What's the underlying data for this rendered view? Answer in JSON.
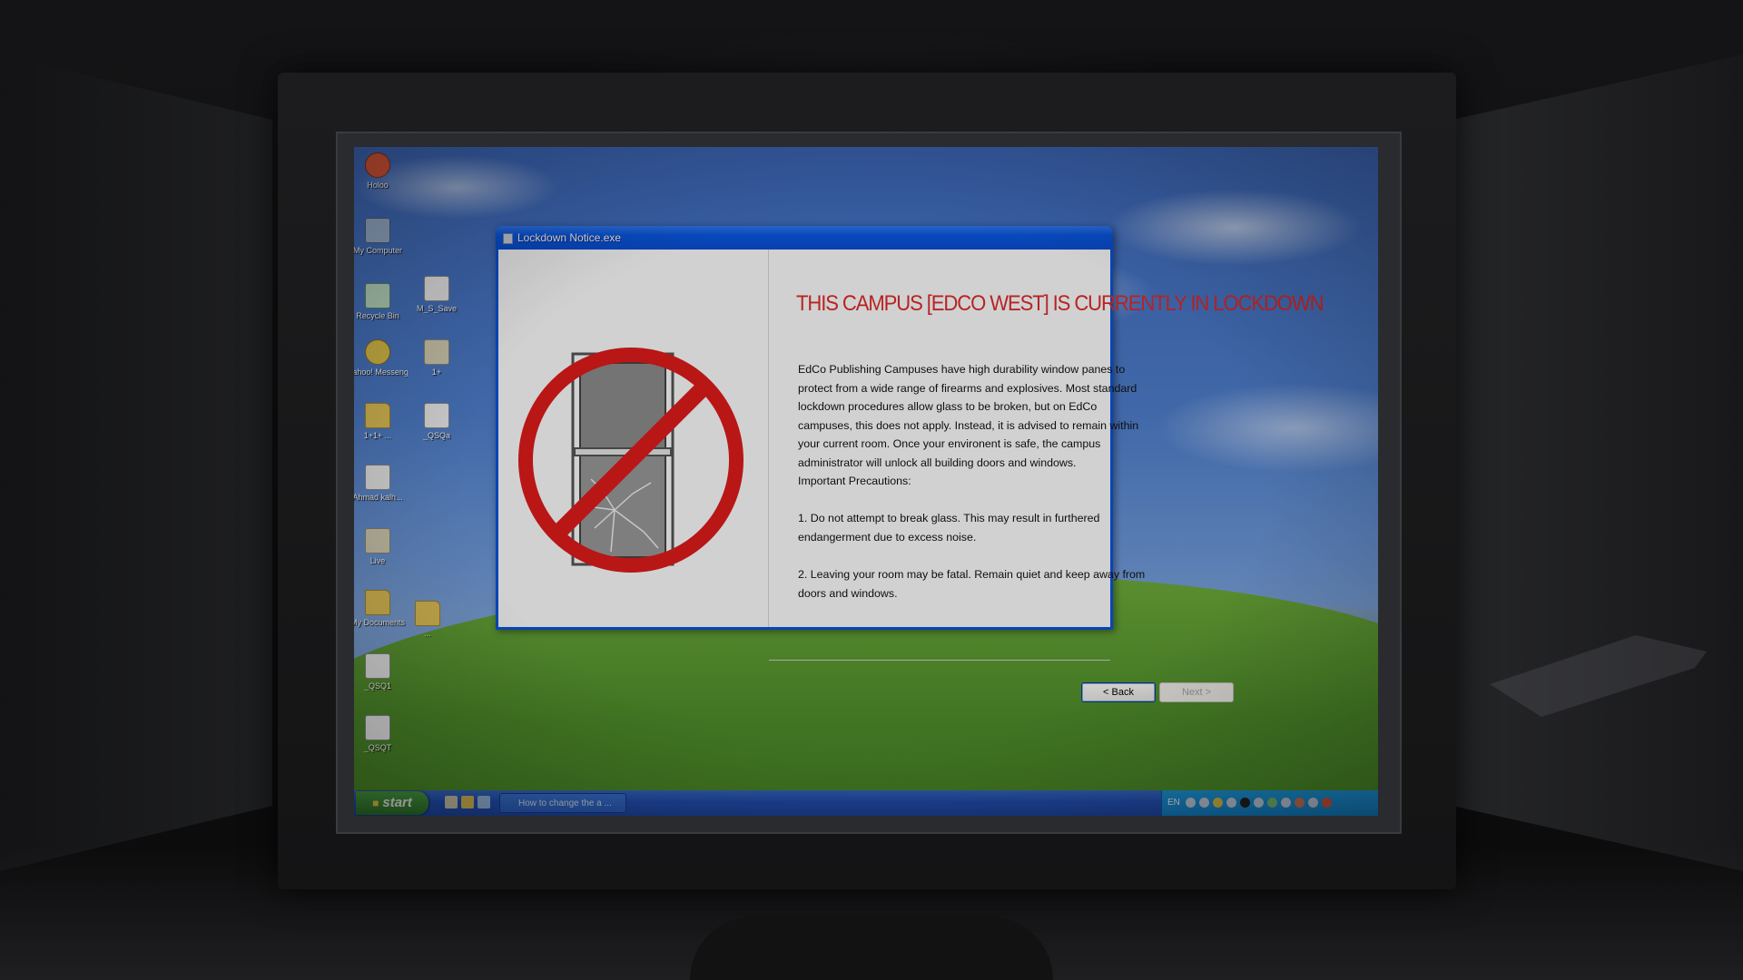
{
  "dialog": {
    "title": "Lockdown Notice.exe",
    "headline": "THIS CAMPUS [EDCO WEST] IS CURRENTLY IN LOCKDOWN",
    "paragraph1": "EdCo Publishing Campuses have high durability window panes to protect from a wide range of firearms and explosives. Most standard lockdown procedures allow glass to be broken, but on EdCo campuses, this does not apply. Instead, it is advised to remain within your current room. Once your environent is safe, the campus administrator will unlock all building doors and windows.",
    "precautions_heading": "Important Precautions:",
    "precaution1": "1. Do not attempt to break glass. This may result in furthered endangerment due to excess noise.",
    "precaution2": "2. Leaving your room may be fatal. Remain quiet and keep away from doors and windows.",
    "back_label": "< Back",
    "next_label": "Next >",
    "headline_color": "#e02b2b",
    "sign_icon": "no-window-breaking-icon"
  },
  "desktop": {
    "icons": [
      {
        "label": "Holoo",
        "icon": "holoo-icon"
      },
      {
        "label": "My Computer",
        "icon": "my-computer-icon"
      },
      {
        "label": "Recycle Bin",
        "icon": "recycle-bin-icon"
      },
      {
        "label": "M_S_Save",
        "icon": "file-icon"
      },
      {
        "label": "Yahoo! Messenger",
        "icon": "yahoo-messenger-icon"
      },
      {
        "label": "1+",
        "icon": "shortcut-icon"
      },
      {
        "label": "1+1+ ...",
        "icon": "folder-icon"
      },
      {
        "label": "_QSQa",
        "icon": "file-icon"
      },
      {
        "label": "Ahmad kalh...",
        "icon": "document-icon"
      },
      {
        "label": "Live",
        "icon": "live-icon"
      },
      {
        "label": "My Documents",
        "icon": "my-documents-icon"
      },
      {
        "label": "...",
        "icon": "folder-icon"
      },
      {
        "label": "_QSQ1",
        "icon": "file-icon"
      },
      {
        "label": "_QSQT",
        "icon": "file-icon"
      }
    ]
  },
  "taskbar": {
    "start_label": "start",
    "task_label": "How to change the a ...",
    "language": "EN",
    "clock": ""
  }
}
